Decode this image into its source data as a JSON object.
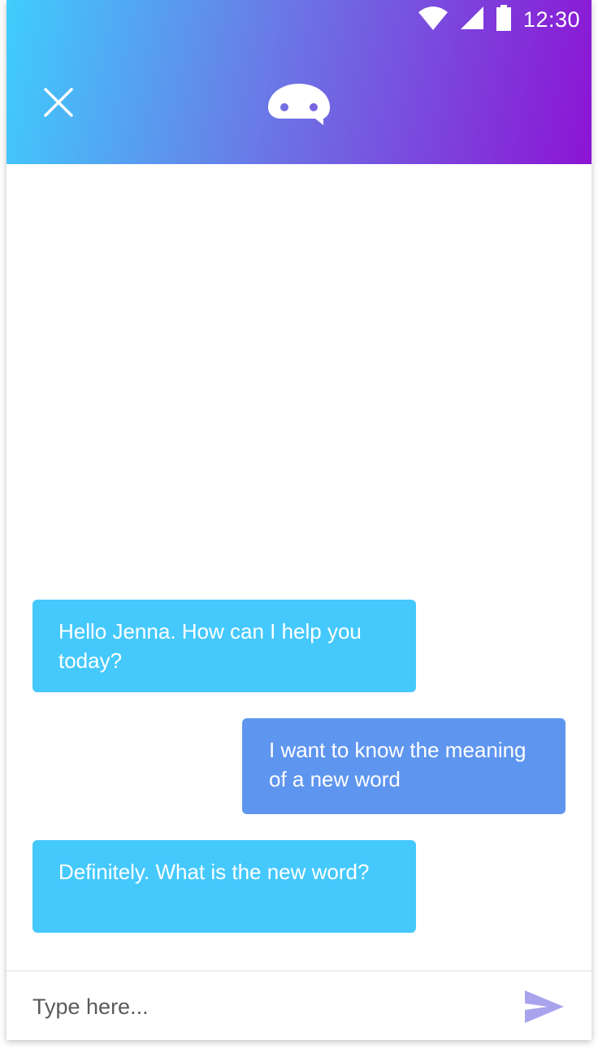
{
  "status_bar": {
    "time": "12:30",
    "icons": [
      "wifi-icon",
      "signal-icon",
      "battery-icon"
    ]
  },
  "header": {
    "close_icon": "close-icon",
    "logo_icon": "chat-bot-logo-icon",
    "gradient": [
      "#3fcdfd",
      "#8c14d4"
    ]
  },
  "messages": [
    {
      "sender": "bot",
      "text": "Hello Jenna. How can I help you today?"
    },
    {
      "sender": "user",
      "text": "I want to know the meaning of a new word"
    },
    {
      "sender": "bot",
      "text": "Definitely. What is the new word?"
    }
  ],
  "input": {
    "placeholder": "Type here...",
    "value": "",
    "send_icon": "send-icon"
  },
  "colors": {
    "bot_bubble": "#45c9fd",
    "user_bubble": "#5e95ef",
    "send_icon": "#a9a3ee"
  }
}
